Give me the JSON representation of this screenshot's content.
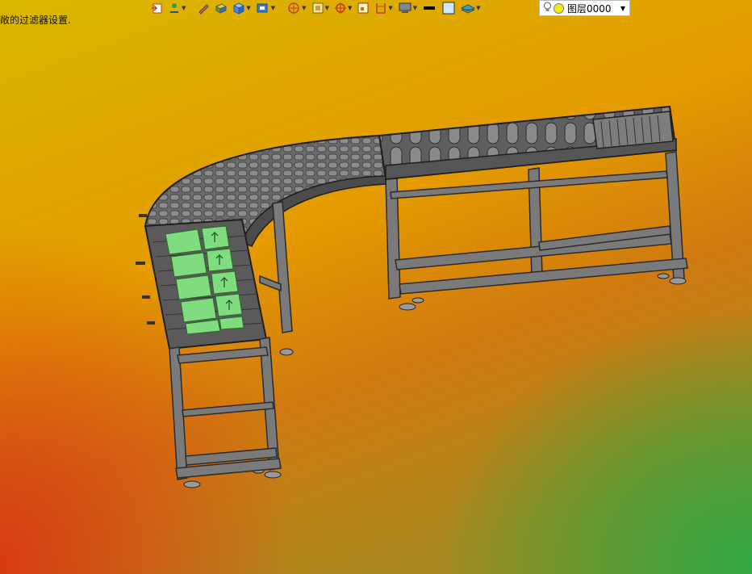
{
  "status": {
    "text": "敞的过滤器设置."
  },
  "toolbar": {
    "items": [
      {
        "icon": "exit-sketch-icon",
        "dropdown": false
      },
      {
        "icon": "smart-dimension-icon",
        "dropdown": true
      },
      {
        "icon": "edit-pen-icon",
        "dropdown": false
      },
      {
        "icon": "extrude-boss-icon",
        "dropdown": false
      },
      {
        "icon": "box-3d-icon",
        "dropdown": true
      },
      {
        "icon": "reference-geometry-icon",
        "dropdown": true
      },
      {
        "icon": "section-view-icon",
        "dropdown": true
      },
      {
        "icon": "view-orientation-icon",
        "dropdown": true
      },
      {
        "icon": "origin-target-icon",
        "dropdown": true
      },
      {
        "icon": "zoom-fit-icon",
        "dropdown": false
      },
      {
        "icon": "measure-icon",
        "dropdown": true
      },
      {
        "icon": "display-style-icon",
        "dropdown": true
      },
      {
        "icon": "line-thickness-icon",
        "dropdown": false
      },
      {
        "icon": "color-swatch-icon",
        "dropdown": false
      },
      {
        "icon": "layer-properties-icon",
        "dropdown": true
      }
    ]
  },
  "layer": {
    "current": "图层0000"
  },
  "colors": {
    "conveyor_frame": "#5a5a5a",
    "conveyor_dark": "#2a2a2a",
    "selected_part": "#7fdc7f"
  }
}
